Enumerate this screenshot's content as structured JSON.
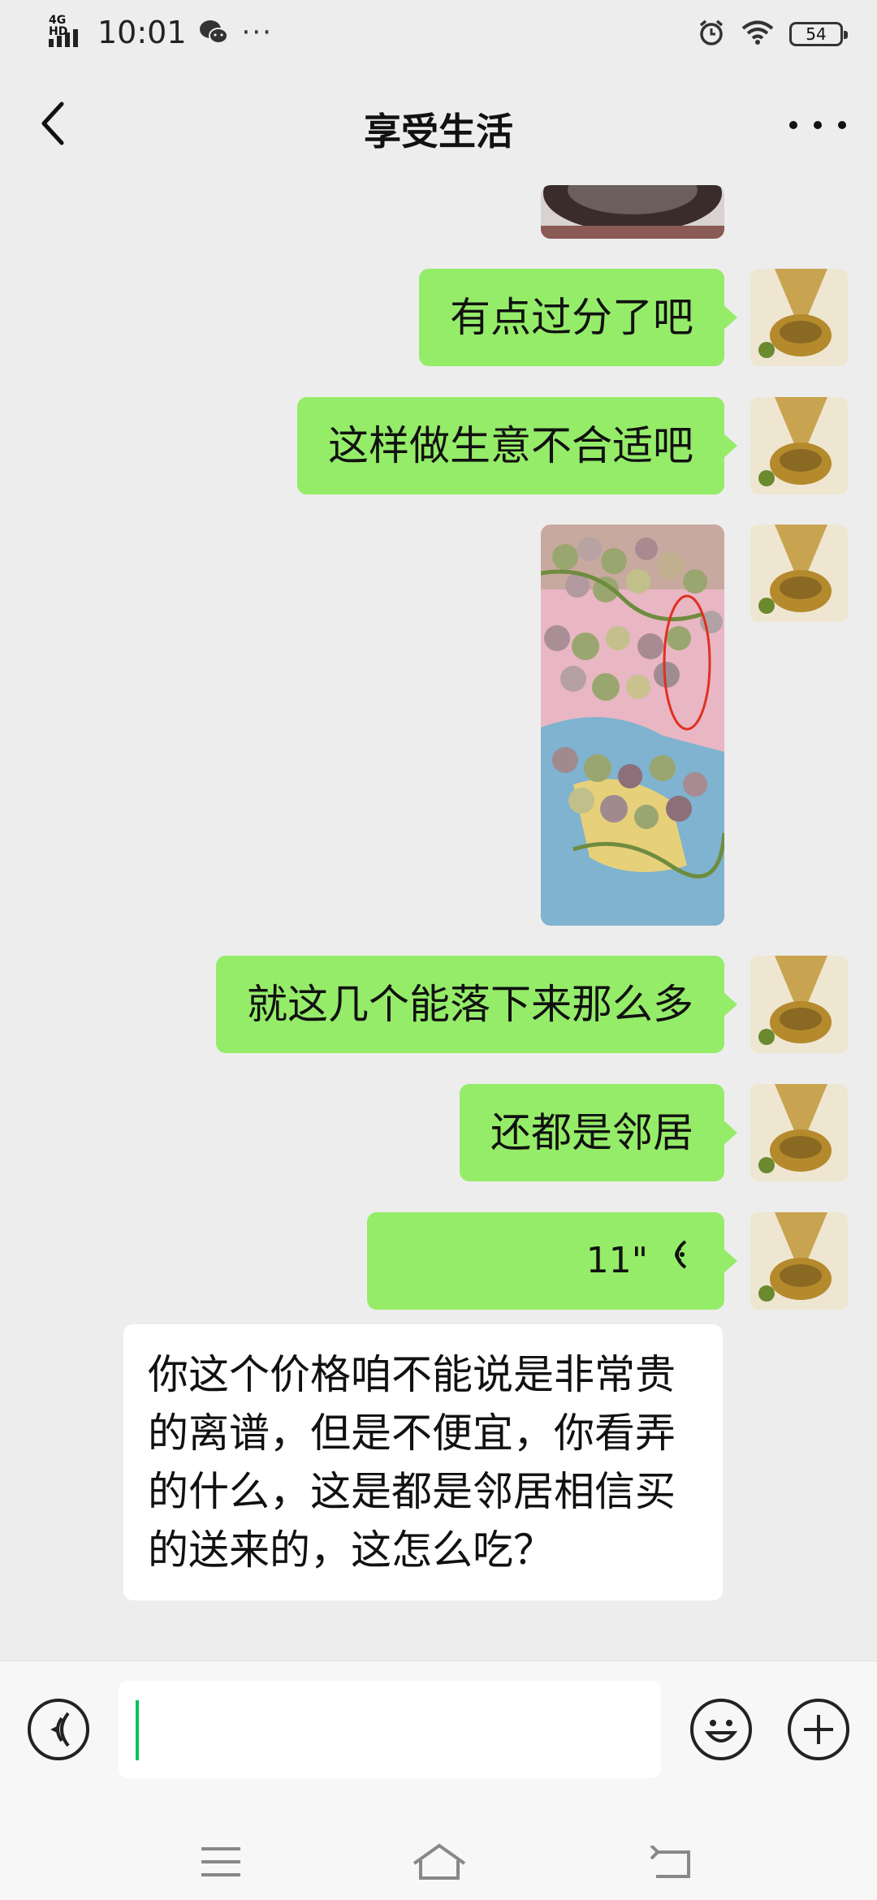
{
  "status_bar": {
    "network": "4G HD",
    "time": "10:01",
    "battery": "54",
    "icons": [
      "signal-icon",
      "wechat-icon",
      "more-dots-icon",
      "alarm-icon",
      "wifi-icon",
      "battery-icon"
    ]
  },
  "header": {
    "title": "享受生活",
    "back_icon": "chevron-left-icon",
    "more_icon": "more-icon"
  },
  "messages": [
    {
      "type": "image",
      "direction": "out",
      "description_icon": "photo"
    },
    {
      "type": "text",
      "direction": "out",
      "text": "有点过分了吧"
    },
    {
      "type": "text",
      "direction": "out",
      "text": "这样做生意不合适吧"
    },
    {
      "type": "image",
      "direction": "out"
    },
    {
      "type": "text",
      "direction": "out",
      "text": "就这几个能落下来那么多"
    },
    {
      "type": "text",
      "direction": "out",
      "text": "还都是邻居"
    },
    {
      "type": "voice",
      "direction": "out",
      "duration": "11\""
    },
    {
      "type": "text",
      "direction": "in",
      "text": "你这个价格咱不能说是非常贵的离谱，但是不便宜，你看弄的什么，这是都是邻居相信买的送来的，这怎么吃？"
    }
  ],
  "colors": {
    "outgoing_bubble": "#95ec69",
    "incoming_bubble": "#ffffff",
    "background": "#ededed",
    "caret": "#07c160"
  },
  "input": {
    "value": "",
    "voice_icon": "voice-icon",
    "emoji_icon": "emoji-icon",
    "plus_icon": "plus-icon"
  },
  "nav": {
    "icons": [
      "menu-icon",
      "home-icon",
      "back-icon"
    ]
  }
}
